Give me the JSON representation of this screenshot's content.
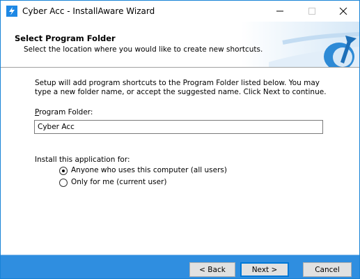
{
  "window": {
    "title": "Cyber Acc - InstallAware Wizard",
    "accent_color": "#1883d7",
    "footer_color": "#2f8ee0",
    "controls": {
      "minimize_icon": "minimize-icon",
      "maximize_icon": "maximize-icon",
      "close_icon": "close-icon"
    }
  },
  "header": {
    "title": "Select Program Folder",
    "subtitle": "Select the location where you would like to create new shortcuts."
  },
  "body": {
    "intro": "Setup will add program shortcuts to the Program Folder listed below. You may type a new folder name, or accept the suggested name. Click Next to continue.",
    "folder_label_underlined": "P",
    "folder_label_rest": "rogram Folder:",
    "folder_value": "Cyber Acc",
    "install_for_label": "Install this application for:",
    "options": [
      {
        "label": "Anyone who uses this computer (all users)",
        "selected": true
      },
      {
        "label": "Only for me (current user)",
        "selected": false
      }
    ]
  },
  "footer": {
    "back_label": "< Back",
    "next_label": "Next >",
    "cancel_label": "Cancel"
  }
}
